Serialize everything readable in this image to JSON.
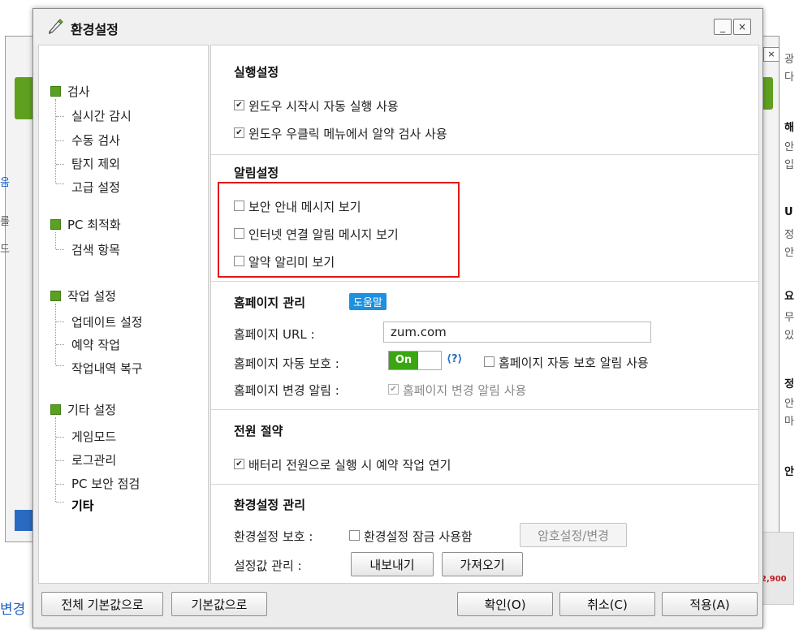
{
  "background": {
    "fragments_right": [
      "광",
      "다",
      "해",
      "안",
      "입",
      "U",
      "정",
      "안",
      "요",
      "무",
      "있",
      "정",
      "안",
      "마",
      "안"
    ],
    "fragments_left": [
      "음",
      "를",
      "드"
    ],
    "bottom_left_text": "변경",
    "ad_price": "2,900"
  },
  "dialog": {
    "title": "환경설정",
    "minimize_label": "_",
    "close_label": "×"
  },
  "nav": [
    {
      "label": "검사",
      "children": [
        "실시간 감시",
        "수동 검사",
        "탐지 제외",
        "고급 설정"
      ]
    },
    {
      "label": "PC 최적화",
      "children": [
        "검색 항목"
      ]
    },
    {
      "label": "작업 설정",
      "children": [
        "업데이트 설정",
        "예약 작업",
        "작업내역 복구"
      ]
    },
    {
      "label": "기타 설정",
      "children": [
        "게임모드",
        "로그관리",
        "PC 보안 점검",
        "기타"
      ]
    }
  ],
  "sections": {
    "run": {
      "title": "실행설정",
      "options": [
        {
          "label": "윈도우 시작시 자동 실행 사용",
          "checked": true
        },
        {
          "label": "윈도우 우클릭 메뉴에서 알약 검사 사용",
          "checked": true
        }
      ]
    },
    "notify": {
      "title": "알림설정",
      "options": [
        {
          "label": "보안 안내 메시지 보기",
          "checked": false
        },
        {
          "label": "인터넷 연결 알림 메시지 보기",
          "checked": false
        },
        {
          "label": "알약 알리미 보기",
          "checked": false
        }
      ]
    },
    "homepage": {
      "title": "홈페이지 관리",
      "help_label": "도움말",
      "url_label": "홈페이지 URL :",
      "url_value": "zum.com",
      "protect_label": "홈페이지 자동 보호 :",
      "toggle_label": "On",
      "toggle_help": "?",
      "protect_alert_label": "홈페이지 자동 보호 알림 사용",
      "change_label": "홈페이지 변경 알림 :",
      "change_option_label": "홈페이지 변경 알림 사용"
    },
    "power": {
      "title": "전원 절약",
      "options": [
        {
          "label": "배터리 전원으로 실행 시 예약 작업 연기",
          "checked": true
        }
      ]
    },
    "config": {
      "title": "환경설정 관리",
      "protect_label": "환경설정 보호 :",
      "lock_label": "환경설정 잠금 사용함",
      "password_button": "암호설정/변경",
      "manage_label": "설정값 관리 :",
      "export_button": "내보내기",
      "import_button": "가져오기"
    }
  },
  "footer": {
    "reset_all": "전체 기본값으로",
    "reset": "기본값으로",
    "ok": "확인(O)",
    "cancel": "취소(C)",
    "apply": "적용(A)"
  },
  "colors": {
    "accent_green": "#3aa612",
    "help_blue": "#1e90e0",
    "highlight_red": "#e01818"
  }
}
